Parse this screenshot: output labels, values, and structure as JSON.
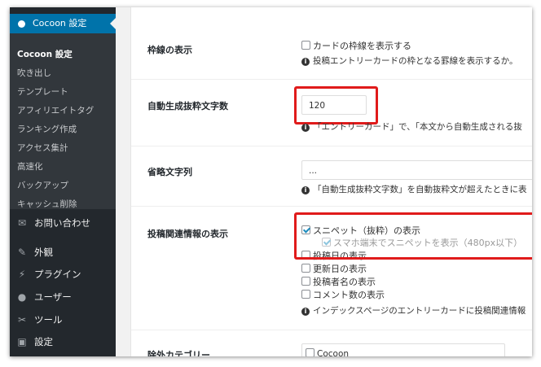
{
  "sidebar": {
    "active": "Cocoon 設定",
    "submenu": [
      "Cocoon 設定",
      "吹き出し",
      "テンプレート",
      "アフィリエイトタグ",
      "ランキング作成",
      "アクセス集計",
      "高速化",
      "バックアップ",
      "キャッシュ削除"
    ],
    "menu": [
      {
        "label": "お問い合わせ",
        "icon": "envelope-icon"
      },
      {
        "label": "外観",
        "icon": "paintbrush-icon"
      },
      {
        "label": "プラグイン",
        "icon": "plugin-icon"
      },
      {
        "label": "ユーザー",
        "icon": "user-icon"
      },
      {
        "label": "ツール",
        "icon": "wrench-icon"
      },
      {
        "label": "設定",
        "icon": "settings-icon"
      }
    ]
  },
  "settings": {
    "card_border": {
      "label": "枠線の表示",
      "checkbox": "カードの枠線を表示する",
      "info": "投稿エントリーカードの枠となる罫線を表示するか。"
    },
    "excerpt_length": {
      "label": "自動生成抜粋文字数",
      "value": "120",
      "info": "「エントリーカード」で、「本文から自動生成される抜"
    },
    "ellipsis": {
      "label": "省略文字列",
      "value": "...",
      "info": "「自動生成抜粋文字数」を自動抜粋文が超えたときに表"
    },
    "post_info": {
      "label": "投稿関連情報の表示",
      "options": [
        {
          "text": "スニペット（抜粋）の表示",
          "checked": true
        },
        {
          "text": "スマホ端末でスニペットを表示（480px以下）",
          "checked": true
        },
        {
          "text": "投稿日の表示",
          "checked": false
        },
        {
          "text": "更新日の表示",
          "checked": false
        },
        {
          "text": "投稿者名の表示",
          "checked": false
        },
        {
          "text": "コメント数の表示",
          "checked": false
        }
      ],
      "info": "インデックスページのエントリーカードに投稿関連情報"
    },
    "exclude_category": {
      "label": "除外カテゴリー",
      "option": "Cocoon"
    }
  },
  "colors": {
    "highlight": "#e01b1b",
    "accent": "#0073aa",
    "sidebar": "#23282d"
  }
}
